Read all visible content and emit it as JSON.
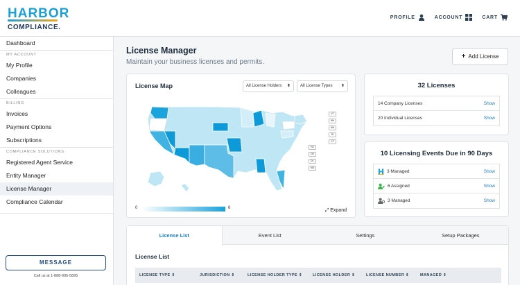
{
  "brand": {
    "line1": "HARBOR",
    "line2": "COMPLIANCE."
  },
  "topnav": {
    "profile": "PROFILE",
    "account": "ACCOUNT",
    "cart": "CART"
  },
  "sidebar": {
    "dashboard": "Dashboard",
    "section_account": "MY ACCOUNT",
    "my_profile": "My Profile",
    "companies": "Companies",
    "colleagues": "Colleagues",
    "section_billing": "BILLING",
    "invoices": "Invoices",
    "payment_options": "Payment Options",
    "subscriptions": "Subscriptions",
    "section_solutions": "COMPLIANCE SOLUTIONS",
    "registered_agent": "Registered Agent Service",
    "entity_manager": "Entity Manager",
    "license_manager": "License Manager",
    "compliance_calendar": "Compliance Calendar",
    "message_button": "MESSAGE",
    "call_us": "Call us at 1-888-995-5895"
  },
  "page": {
    "title": "License Manager",
    "subtitle": "Maintain your business licenses and permits.",
    "add_button": "Add License"
  },
  "map": {
    "title": "License Map",
    "filter_holders": "All License Holders",
    "filter_types": "All License Types",
    "legend_min": "0",
    "legend_max": "6",
    "expand": "Expand",
    "small_states": [
      "VT",
      "NH",
      "MA",
      "RI",
      "CT",
      "NJ",
      "DE",
      "DC",
      "MD"
    ]
  },
  "licenses": {
    "header": "32 Licenses",
    "rows": [
      {
        "label": "14 Company Licenses",
        "action": "Show"
      },
      {
        "label": "20 Individual Licenses",
        "action": "Show"
      }
    ]
  },
  "events": {
    "header": "10 Licensing Events Due in 90 Days",
    "rows": [
      {
        "label": "3 Managed",
        "action": "Show",
        "icon": "harbor-h-icon"
      },
      {
        "label": "6 Assigned",
        "action": "Show",
        "icon": "user-assigned-icon"
      },
      {
        "label": "3 Managed",
        "action": "Show",
        "icon": "user-managed-icon"
      }
    ]
  },
  "tabs": [
    "License List",
    "Event List",
    "Settings",
    "Setup Packages"
  ],
  "license_list": {
    "title": "License List",
    "columns": [
      "LICENSE TYPE",
      "JURISDICTION",
      "LICENSE HOLDER TYPE",
      "LICENSE HOLDER",
      "LICENSE NUMBER",
      "MANAGED"
    ]
  },
  "colors": {
    "accent": "#1a7dc4",
    "brand_blue": "#1a9fd9",
    "navy": "#1e4d86"
  }
}
